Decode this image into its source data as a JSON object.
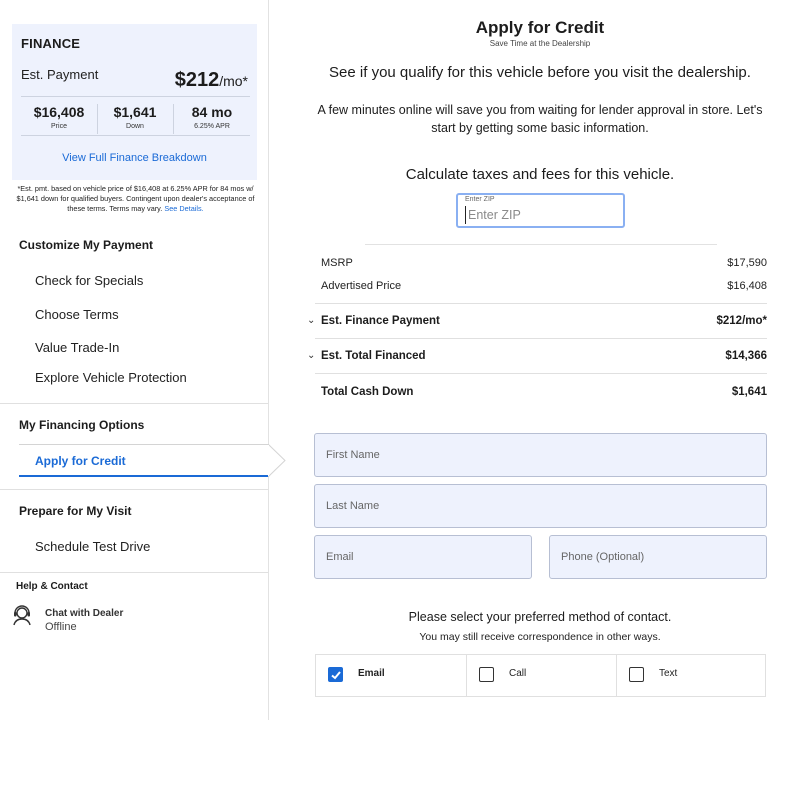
{
  "finance": {
    "title": "FINANCE",
    "est_label": "Est. Payment",
    "est_amount": "$212",
    "est_suffix": "/mo*",
    "stats": [
      {
        "value": "$16,408",
        "label": "Price"
      },
      {
        "value": "$1,641",
        "label": "Down"
      },
      {
        "value": "84 mo",
        "label": "6.25% APR"
      }
    ],
    "breakdown_link": "View Full Finance Breakdown",
    "fine_print": "*Est. pmt. based on vehicle price of $16,408 at 6.25% APR for 84 mos w/ $1,641 down for qualified buyers. Contingent upon dealer's acceptance of these terms. Terms may vary.",
    "see_details": "See Details."
  },
  "sidebar": {
    "customize_heading": "Customize My Payment",
    "customize_items": [
      "Check for Specials",
      "Choose Terms",
      "Value Trade-In",
      "Explore Vehicle Protection"
    ],
    "financing_heading": "My Financing Options",
    "financing_active": "Apply for Credit",
    "visit_heading": "Prepare for My Visit",
    "visit_items": [
      "Schedule Test Drive"
    ],
    "help_heading": "Help & Contact",
    "chat_title": "Chat with Dealer",
    "chat_status": "Offline"
  },
  "main": {
    "title": "Apply for Credit",
    "subtitle": "Save Time at the Dealership",
    "lead": "See if you qualify for this vehicle before you visit the dealership.",
    "paragraph": "A few minutes online will save you from waiting for lender approval in store. Let's start by getting some basic information.",
    "calc_heading": "Calculate taxes and fees for this vehicle.",
    "zip_label": "Enter ZIP",
    "zip_placeholder": "Enter ZIP",
    "prices": [
      {
        "label": "MSRP",
        "value": "$17,590"
      },
      {
        "label": "Advertised Price",
        "value": "$16,408"
      }
    ],
    "finance_payment": {
      "label": "Est. Finance Payment",
      "value": "$212/mo*"
    },
    "total_financed": {
      "label": "Est. Total Financed",
      "value": "$14,366"
    },
    "cash_down": {
      "label": "Total Cash Down",
      "value": "$1,641"
    },
    "form": {
      "first_name": "First Name",
      "last_name": "Last Name",
      "email": "Email",
      "phone": "Phone (Optional)"
    },
    "pref_heading": "Please select your preferred method of contact.",
    "pref_note": "You may still receive correspondence in other ways.",
    "contact_options": [
      {
        "label": "Email",
        "checked": true
      },
      {
        "label": "Call",
        "checked": false
      },
      {
        "label": "Text",
        "checked": false
      }
    ]
  },
  "colors": {
    "accent": "#1a6ad6",
    "card_bg": "#eef2fd"
  }
}
